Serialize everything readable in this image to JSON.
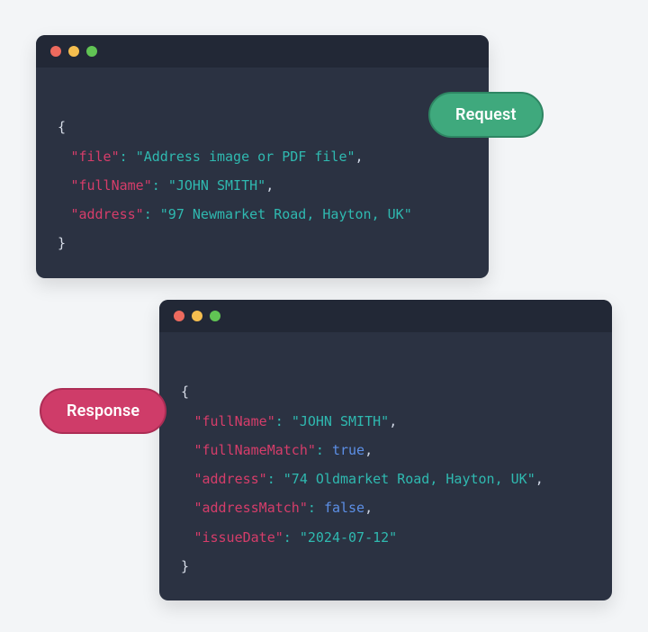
{
  "badges": {
    "request": "Request",
    "response": "Response"
  },
  "request": {
    "open": "{",
    "lines": {
      "l1": {
        "key": "\"file\"",
        "colon": ": ",
        "value": "\"Address image or PDF file\"",
        "comma": ","
      },
      "l2": {
        "key": "\"fullName\"",
        "colon": ": ",
        "value": "\"JOHN SMITH\"",
        "comma": ","
      },
      "l3": {
        "key": "\"address\"",
        "colon": ": ",
        "value": "\"97 Newmarket Road, Hayton, UK\"",
        "comma": ""
      }
    },
    "close": "}"
  },
  "response": {
    "open": "{",
    "lines": {
      "l1": {
        "key": "\"fullName\"",
        "colon": ": ",
        "value": "\"JOHN SMITH\"",
        "comma": ",",
        "type": "string"
      },
      "l2": {
        "key": "\"fullNameMatch\"",
        "colon": ": ",
        "value": "true",
        "comma": ",",
        "type": "bool"
      },
      "l3": {
        "key": "\"address\"",
        "colon": ": ",
        "value": "\"74 Oldmarket Road, Hayton, UK\"",
        "comma": ",",
        "type": "string"
      },
      "l4": {
        "key": "\"addressMatch\"",
        "colon": ": ",
        "value": "false",
        "comma": ",",
        "type": "bool"
      },
      "l5": {
        "key": "\"issueDate\"",
        "colon": ": ",
        "value": "\"2024-07-12\"",
        "comma": "",
        "type": "string"
      }
    },
    "close": "}"
  }
}
